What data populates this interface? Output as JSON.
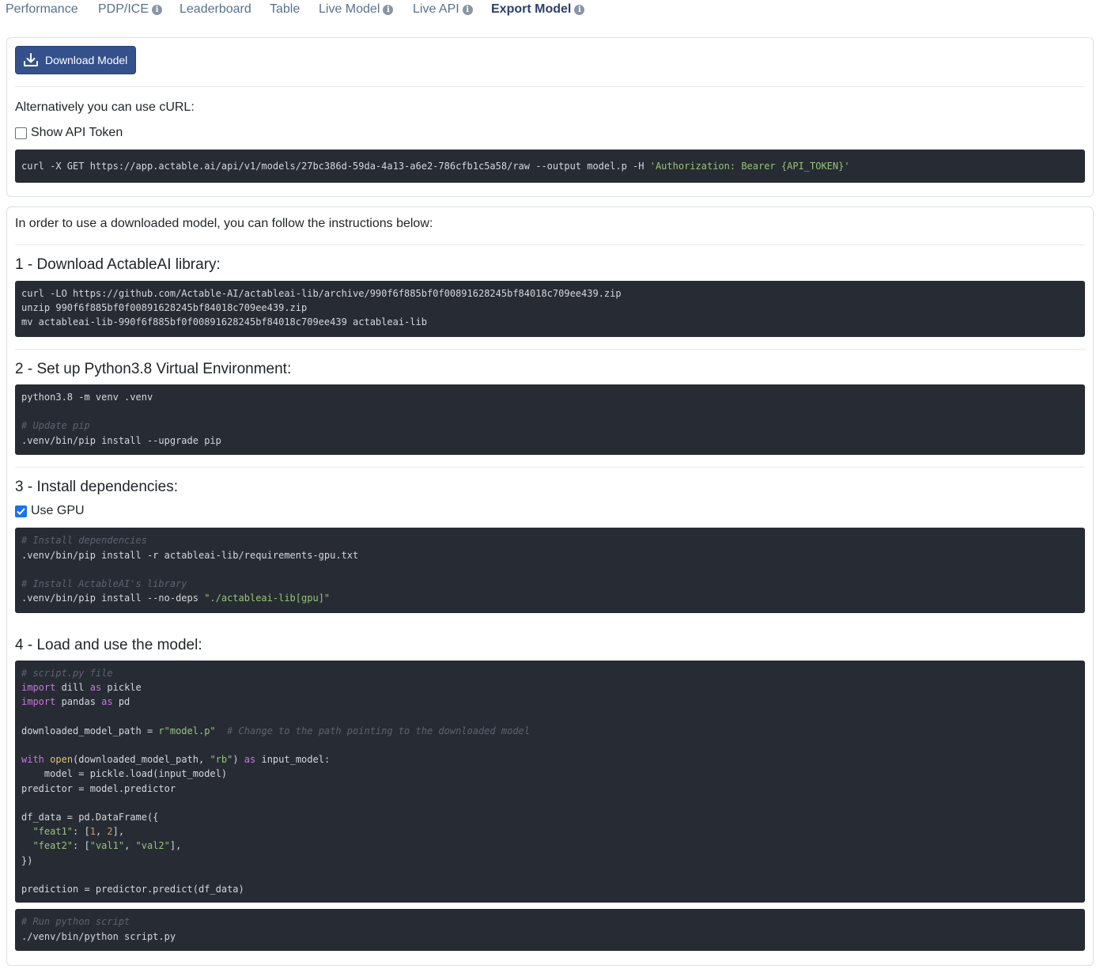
{
  "tabs": [
    {
      "label": "Performance",
      "info": false,
      "active": false
    },
    {
      "label": "PDP/ICE",
      "info": true,
      "active": false
    },
    {
      "label": "Leaderboard",
      "info": false,
      "active": false
    },
    {
      "label": "Table",
      "info": false,
      "active": false
    },
    {
      "label": "Live Model",
      "info": true,
      "active": false
    },
    {
      "label": "Live API",
      "info": true,
      "active": false
    },
    {
      "label": "Export Model",
      "info": true,
      "active": true
    }
  ],
  "download": {
    "button_label": "Download Model",
    "alt_text": "Alternatively you can use cURL:",
    "show_token_label": "Show API Token",
    "show_token_checked": false,
    "curl_prefix": "curl -X GET https://app.actable.ai/api/v1/models/27bc386d-59da-4a13-a6e2-786cfb1c5a58/raw --output model.p -H ",
    "curl_header": "'Authorization: Bearer {API_TOKEN}'"
  },
  "instructions": {
    "intro": "In order to use a downloaded model, you can follow the instructions below:",
    "step1_title": "1 - Download ActableAI library:",
    "step1_lines": [
      "curl -LO https://github.com/Actable-AI/actableai-lib/archive/990f6f885bf0f00891628245bf84018c709ee439.zip",
      "unzip 990f6f885bf0f00891628245bf84018c709ee439.zip",
      "mv actableai-lib-990f6f885bf0f00891628245bf84018c709ee439 actableai-lib"
    ],
    "step2_title": "2 - Set up Python3.8 Virtual Environment:",
    "step2_line1": "python3.8 -m venv .venv",
    "step2_comment": "# Update pip",
    "step2_line2": ".venv/bin/pip install --upgrade pip",
    "step3_title": "3 - Install dependencies:",
    "gpu_label": "Use GPU",
    "gpu_checked": true,
    "step3_comment1": "# Install dependencies",
    "step3_line1": ".venv/bin/pip install -r actableai-lib/requirements-gpu.txt",
    "step3_comment2": "# Install ActableAI's library",
    "step3_line2_prefix": ".venv/bin/pip install --no-deps ",
    "step3_line2_str": "\"./actableai-lib[gpu]\"",
    "step4_title": "4 - Load and use the model:",
    "run_comment": "# Run python script",
    "run_line": "./venv/bin/python script.py"
  },
  "colors": {
    "accent": "#34518c",
    "code_bg": "#272b33",
    "comment": "#5c6370",
    "keyword": "#c678dd",
    "string": "#98c379",
    "number": "#d19a66",
    "builtin": "#e5c07b"
  }
}
